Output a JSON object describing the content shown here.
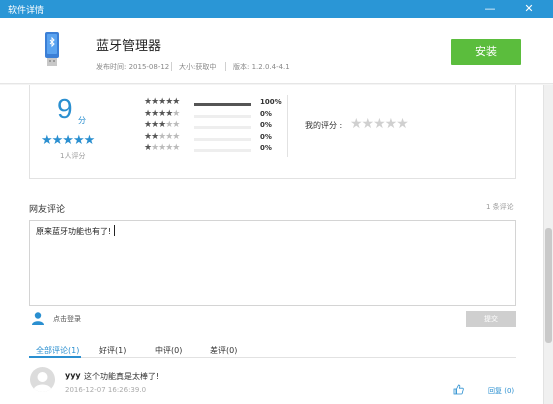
{
  "window": {
    "title": "软件详情",
    "minimize": "—",
    "close": "✕"
  },
  "app": {
    "name": "蓝牙管理器",
    "publish_date": "发布时间: 2015-08-12",
    "size": "大小:获取中",
    "version": "版本: 1.2.0.4-4.1",
    "install_label": "安装"
  },
  "rating": {
    "score": "9",
    "unit": "分",
    "stars": "★★★★★",
    "count": "1人评分",
    "distribution": [
      {
        "stars": 5,
        "percent": 100,
        "label": "100%"
      },
      {
        "stars": 4,
        "percent": 0,
        "label": "0%"
      },
      {
        "stars": 3,
        "percent": 0,
        "label": "0%"
      },
      {
        "stars": 2,
        "percent": 0,
        "label": "0%"
      },
      {
        "stars": 1,
        "percent": 0,
        "label": "0%"
      }
    ],
    "my_rating_label": "我的评分 :",
    "my_stars": "★★★★★"
  },
  "comments": {
    "title": "网友评论",
    "count": "1 条评论",
    "input_value": "原来蓝牙功能也有了!",
    "login_label": "点击登录",
    "submit_label": "提交",
    "tabs": [
      {
        "label": "全部评论(1)",
        "active": true
      },
      {
        "label": "好评(1)",
        "active": false
      },
      {
        "label": "中评(0)",
        "active": false
      },
      {
        "label": "差评(0)",
        "active": false
      }
    ],
    "items": [
      {
        "user": "yyy",
        "text": "这个功能真是太棒了!",
        "time": "2016-12-07 16:26:39.0",
        "reply_label": "回复 (0)"
      }
    ]
  },
  "colors": {
    "titlebar": "#2a96d6",
    "accent": "#2a8fd0",
    "install": "#5bbd3d"
  }
}
